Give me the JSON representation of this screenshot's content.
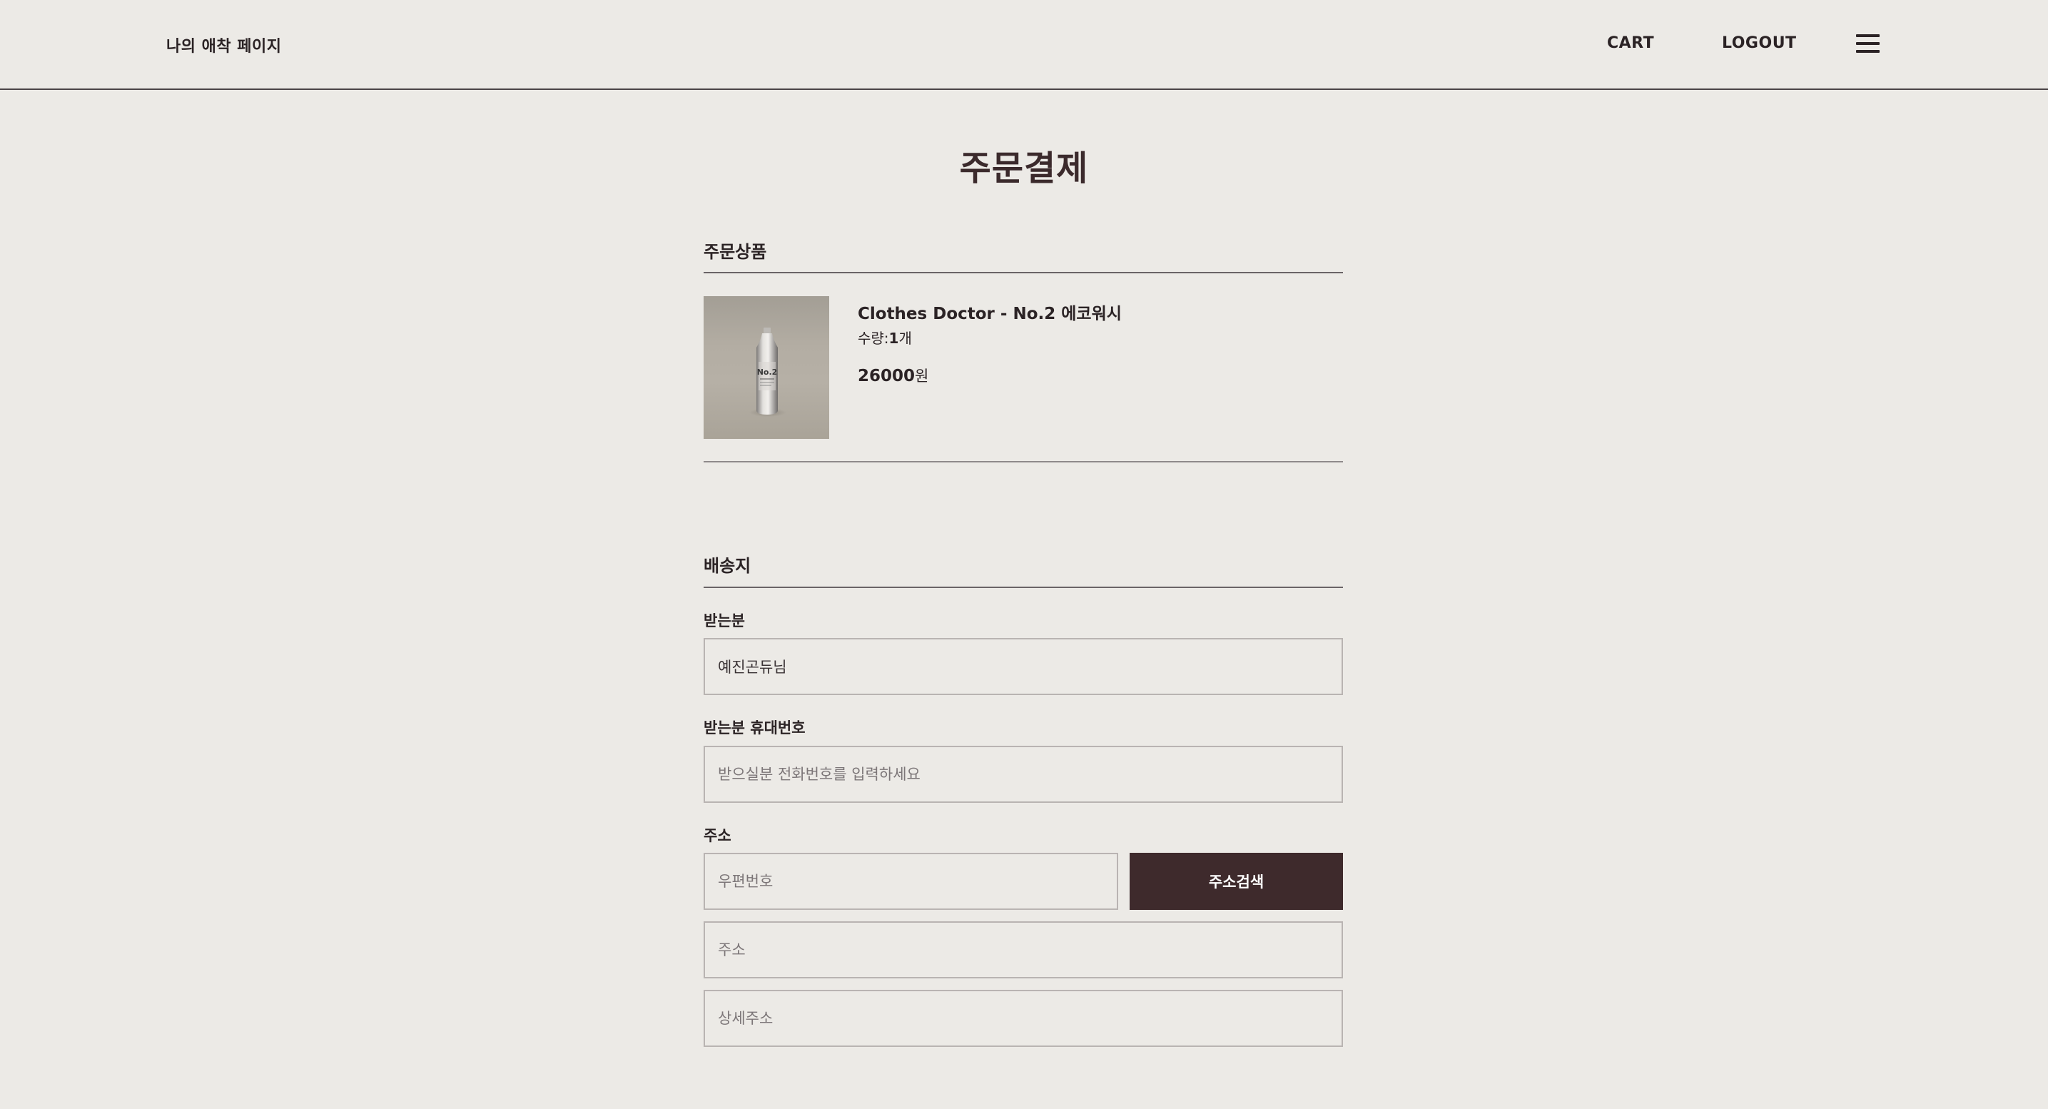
{
  "header": {
    "brand": "나의 애착 페이지",
    "nav": {
      "cart": "CART",
      "logout": "LOGOUT"
    },
    "menu_icon": "hamburger-menu-icon"
  },
  "page_title": "주문결제",
  "order_items": {
    "title": "주문상품",
    "items": [
      {
        "name": "Clothes Doctor - No.2 에코워시",
        "qty_label": "수량:",
        "qty_value": "1",
        "qty_unit": "개",
        "price": "26000",
        "price_unit": "원",
        "image": "product-bottle-image"
      }
    ]
  },
  "shipping": {
    "title": "배송지",
    "recipient_label": "받는분",
    "recipient_value": "예진곤듀님",
    "phone_label": "받는분 휴대번호",
    "phone_placeholder": "받으실분 전화번호를 입력하세요",
    "address_label": "주소",
    "postcode_placeholder": "우편번호",
    "search_button": "주소검색",
    "address_placeholder": "주소",
    "detail_placeholder": "상세주소"
  },
  "colors": {
    "background": "#ECEAE6",
    "accent": "#3E2A2C",
    "text": "#2B2325"
  }
}
